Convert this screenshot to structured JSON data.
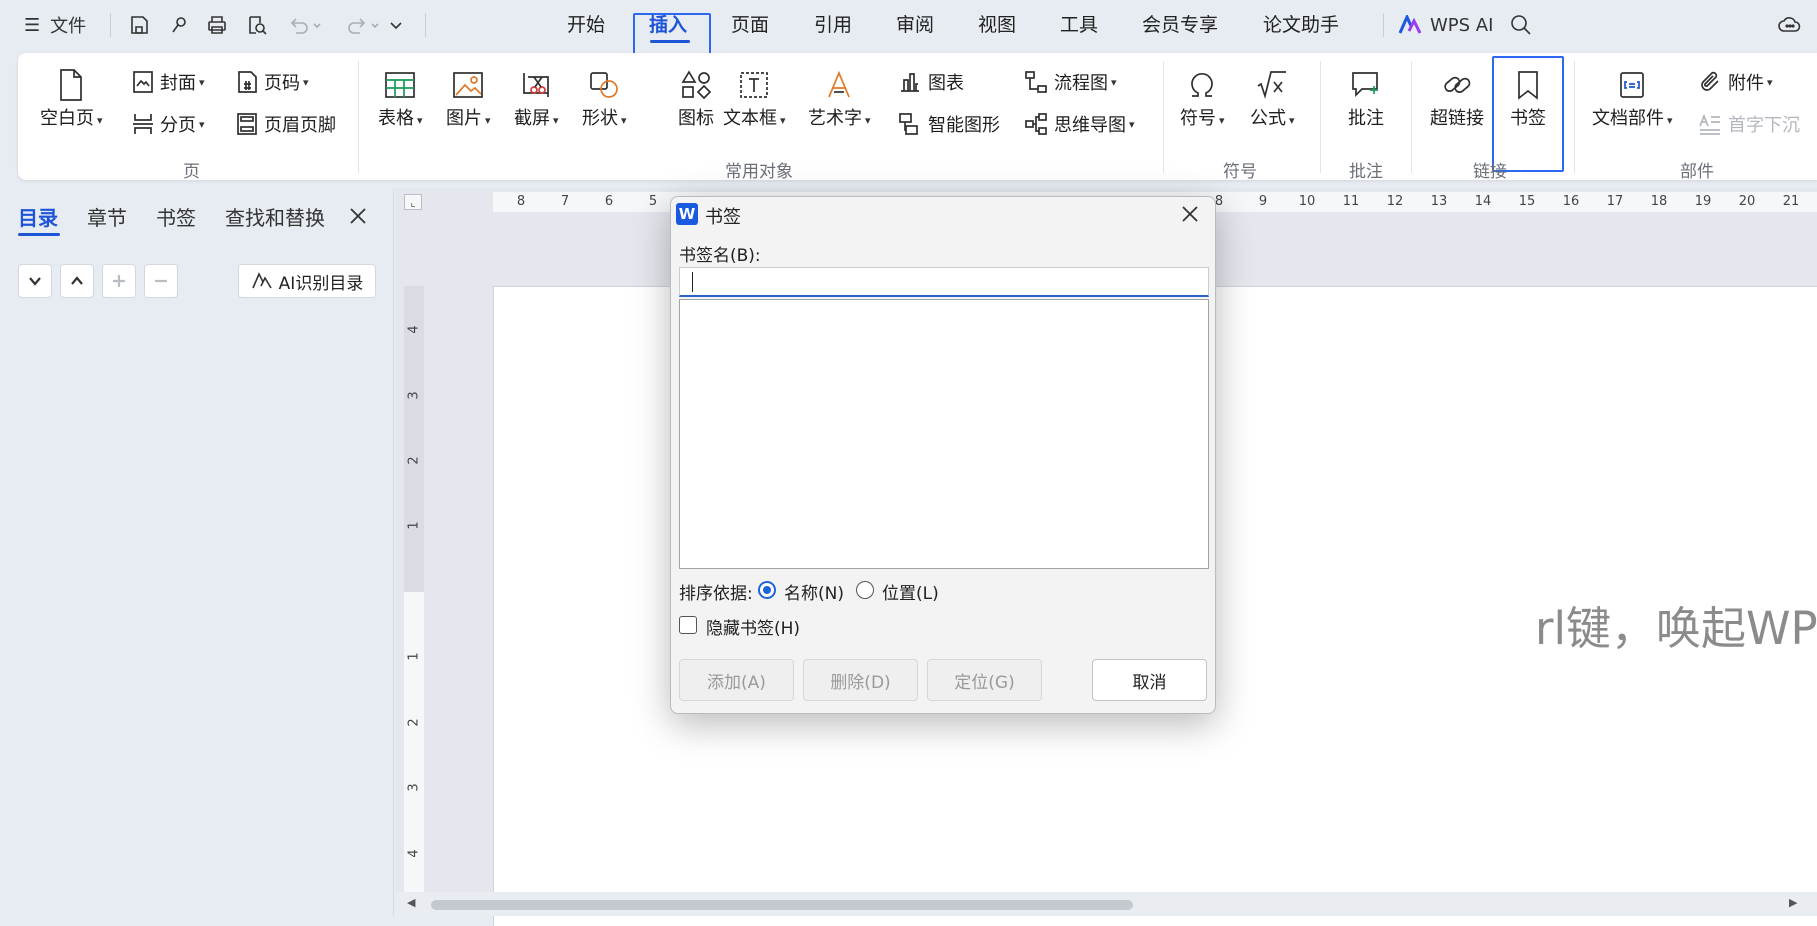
{
  "topbar": {
    "menu_label": "文件",
    "tabs": [
      "开始",
      "插入",
      "页面",
      "引用",
      "审阅",
      "视图",
      "工具",
      "会员专享",
      "论文助手"
    ],
    "active_tab": "插入",
    "wps_ai_label": "WPS AI"
  },
  "ribbon": {
    "page_group": {
      "blank_page": "空白页",
      "cover": "封面",
      "page_number": "页码",
      "page_break": "分页",
      "header_footer": "页眉页脚",
      "group_label": "页"
    },
    "objects_group": {
      "table": "表格",
      "picture": "图片",
      "screenshot": "截屏",
      "shape": "形状",
      "icon": "图标",
      "textbox": "文本框",
      "wordart": "艺术字",
      "chart": "图表",
      "smart_graphic": "智能图形",
      "flowchart": "流程图",
      "mindmap": "思维导图",
      "group_label": "常用对象"
    },
    "symbol_group": {
      "symbol": "符号",
      "formula": "公式",
      "group_label": "符号"
    },
    "comment_group": {
      "comment": "批注",
      "group_label": "批注"
    },
    "link_group": {
      "hyperlink": "超链接",
      "bookmark": "书签",
      "group_label": "链接"
    },
    "parts_group": {
      "doc_parts": "文档部件",
      "attachment": "附件",
      "drop_cap": "首字下沉",
      "group_label": "部件"
    }
  },
  "left_panel": {
    "tabs": [
      "目录",
      "章节",
      "书签",
      "查找和替换"
    ],
    "active_tab": "目录",
    "ai_toc_button": "AI识别目录"
  },
  "ruler": {
    "horizontal": [
      "8",
      "7",
      "6",
      "5",
      "8",
      "9",
      "10",
      "11",
      "12",
      "13",
      "14",
      "15",
      "16",
      "17",
      "18",
      "19",
      "20",
      "21"
    ],
    "vertical": [
      "4",
      "3",
      "2",
      "1",
      "1",
      "2",
      "3",
      "4"
    ]
  },
  "document": {
    "ai_hint": "rl键，唤起WPS AI"
  },
  "dialog": {
    "title": "书签",
    "name_label": "书签名(B):",
    "name_value": "",
    "sort_label": "排序依据:",
    "sort_options": [
      "名称(N)",
      "位置(L)"
    ],
    "sort_selected": "名称(N)",
    "hide_label": "隐藏书签(H)",
    "hide_checked": false,
    "buttons": {
      "add": "添加(A)",
      "delete": "删除(D)",
      "goto": "定位(G)",
      "cancel": "取消"
    }
  },
  "colors": {
    "accent": "#1e54d8",
    "highlight_box": "#2c69f0",
    "app_background": "#e7ecf2",
    "wps_logo": "#1a5ae0"
  }
}
